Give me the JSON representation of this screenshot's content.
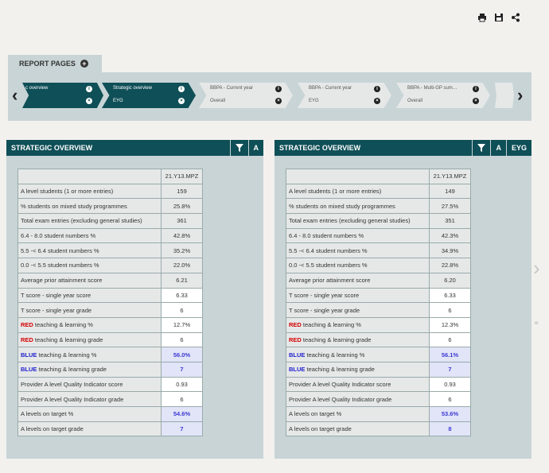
{
  "toolbar": {
    "icons": [
      "print-icon",
      "save-icon",
      "share-icon"
    ]
  },
  "report_pages_label": "REPORT PAGES",
  "carousel": {
    "pages": [
      {
        "title": "c overview",
        "subtitle": "",
        "active": true
      },
      {
        "title": "Strategic overview",
        "subtitle": "EYG",
        "active": true
      },
      {
        "title": "BBPA - Current year",
        "subtitle": "Overall",
        "active": false
      },
      {
        "title": "BBPA - Current year",
        "subtitle": "EYG",
        "active": false
      },
      {
        "title": "BBPA - Multi-GP sum…",
        "subtitle": "Overall",
        "active": false
      }
    ]
  },
  "left_panel": {
    "title": "STRATEGIC OVERVIEW",
    "extra_label": "A",
    "column_header": "21.Y13.MPZ",
    "rows": [
      {
        "label": "A level students (1 or more entries)",
        "value": "159"
      },
      {
        "label": "% students on mixed study programmes",
        "value": "25.8%"
      },
      {
        "label": "Total exam entries (excluding general studies)",
        "value": "361"
      },
      {
        "label": "6.4 - 8.0 student numbers %",
        "value": "42.8%"
      },
      {
        "label": "5.5 -< 6.4 student numbers %",
        "value": "35.2%"
      },
      {
        "label": "0.0 -< 5.5 student numbers %",
        "value": "22.0%"
      },
      {
        "label": "Average prior attainment score",
        "value": "6.21"
      },
      {
        "label": "T score - single year score",
        "value": "6.33"
      },
      {
        "label": "T score - single year grade",
        "value": "6"
      },
      {
        "prefix": "RED",
        "label": " teaching & learning %",
        "value": "12.7%"
      },
      {
        "prefix": "RED",
        "label": " teaching & learning grade",
        "value": "6"
      },
      {
        "prefix": "BLUE",
        "label": " teaching & learning %",
        "value": "56.0%"
      },
      {
        "prefix": "BLUE",
        "label": " teaching & learning grade",
        "value": "7"
      },
      {
        "label": "Provider A level Quality Indicator score",
        "value": "0.93"
      },
      {
        "label": "Provider A level Quality Indicator grade",
        "value": "6"
      },
      {
        "label": "A levels on target %",
        "value": "54.6%"
      },
      {
        "label": "A levels on target grade",
        "value": "7"
      }
    ]
  },
  "right_panel": {
    "title": "STRATEGIC OVERVIEW",
    "extra_label": "A",
    "extra_label2": "EYG",
    "column_header": "21.Y13.MPZ",
    "rows": [
      {
        "label": "A level students (1 or more entries)",
        "value": "149"
      },
      {
        "label": "% students on mixed study programmes",
        "value": "27.5%"
      },
      {
        "label": "Total exam entries (excluding general studies)",
        "value": "351"
      },
      {
        "label": "6.4 - 8.0 student numbers %",
        "value": "42.3%"
      },
      {
        "label": "5.5 -< 6.4 student numbers %",
        "value": "34.9%"
      },
      {
        "label": "0.0 -< 5.5 student numbers %",
        "value": "22.8%"
      },
      {
        "label": "Average prior attainment score",
        "value": "6.20"
      },
      {
        "label": "T score - single year score",
        "value": "6.33"
      },
      {
        "label": "T score - single year grade",
        "value": "6"
      },
      {
        "prefix": "RED",
        "label": " teaching & learning %",
        "value": "12.3%"
      },
      {
        "prefix": "RED",
        "label": " teaching & learning grade",
        "value": "6"
      },
      {
        "prefix": "BLUE",
        "label": " teaching & learning %",
        "value": "56.1%"
      },
      {
        "prefix": "BLUE",
        "label": " teaching & learning grade",
        "value": "7"
      },
      {
        "label": "Provider A level Quality Indicator score",
        "value": "0.93"
      },
      {
        "label": "Provider A level Quality Indicator grade",
        "value": "6"
      },
      {
        "label": "A levels on target %",
        "value": "53.6%"
      },
      {
        "label": "A levels on target grade",
        "value": "8"
      }
    ]
  },
  "colors": {
    "header": "#0f4f57",
    "panel": "#c8d4d6",
    "red": "#d40000",
    "blue": "#2222cc"
  }
}
